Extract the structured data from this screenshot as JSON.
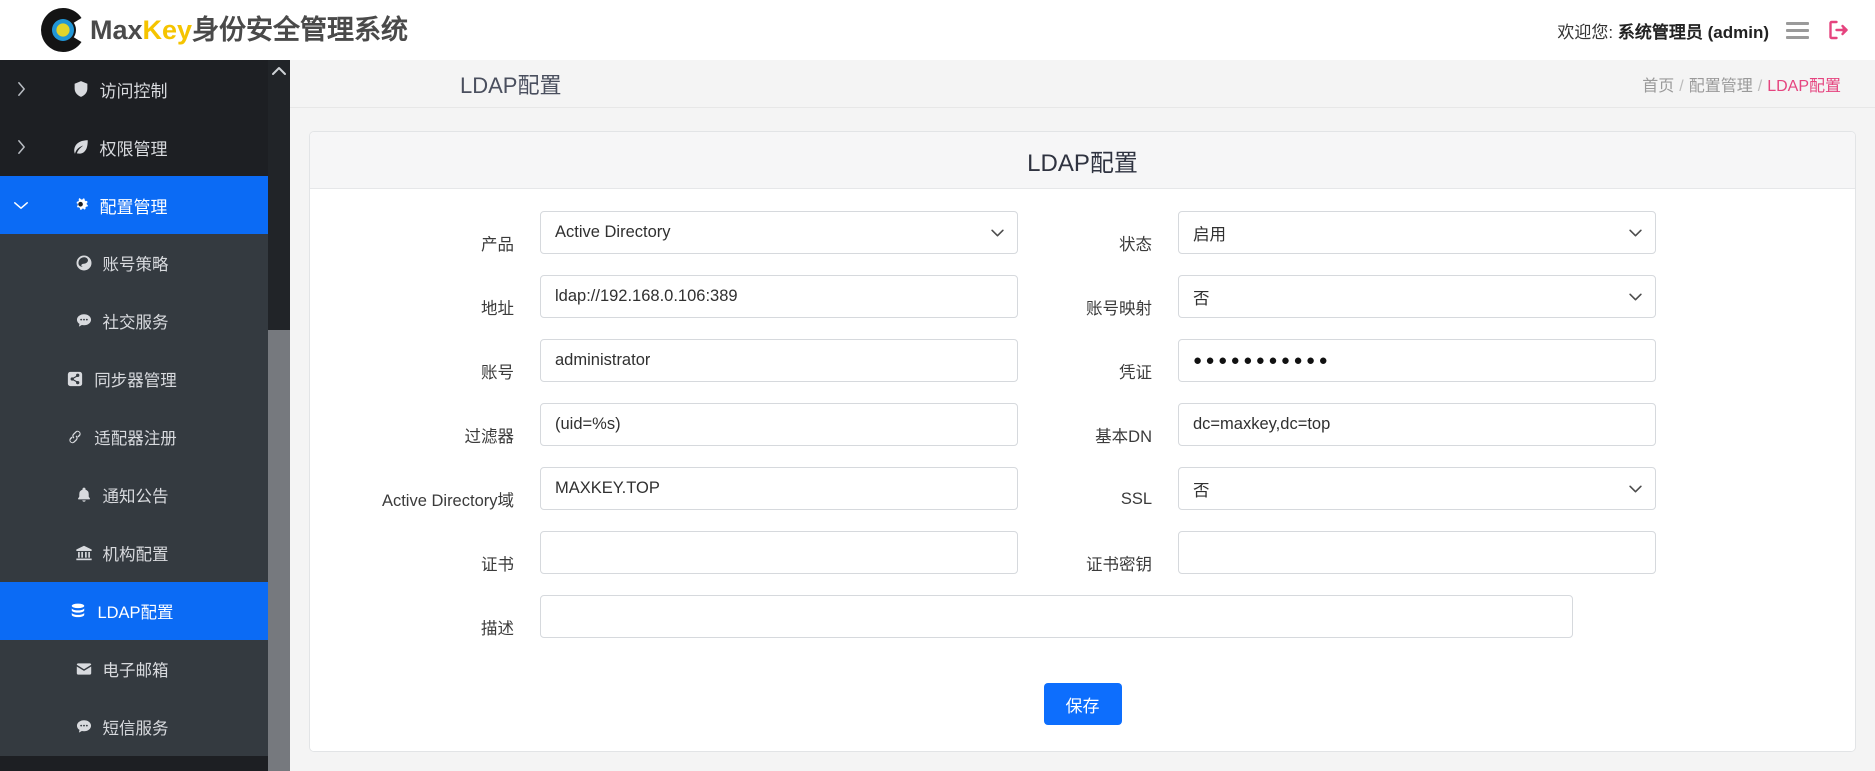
{
  "header": {
    "brand_max": "Max",
    "brand_key": "Key",
    "brand_cn": "身份安全管理系统",
    "welcome_prefix": "欢迎您:",
    "user_name": "系统管理员 (admin)",
    "menu_icon": "hamburger-menu-icon",
    "logout_icon": "sign-out-icon"
  },
  "sidebar": {
    "scroll_up_icon": "chevron-up-icon",
    "items": [
      {
        "label": "访问控制",
        "icon": "shield-icon",
        "caret": "chevron-right-icon",
        "level": "top",
        "active": false
      },
      {
        "label": "权限管理",
        "icon": "leaf-icon",
        "caret": "chevron-right-icon",
        "level": "top",
        "active": false
      },
      {
        "label": "配置管理",
        "icon": "gears-icon",
        "caret": "chevron-down-icon",
        "level": "top",
        "active": true
      },
      {
        "label": "账号策略",
        "icon": "hurricane-icon",
        "caret": "",
        "level": "sub",
        "active": false
      },
      {
        "label": "社交服务",
        "icon": "comment-dots-icon",
        "caret": "",
        "level": "sub",
        "active": false
      },
      {
        "label": "同步器管理",
        "icon": "share-square-icon",
        "caret": "",
        "level": "sub",
        "active": false
      },
      {
        "label": "适配器注册",
        "icon": "link-icon",
        "caret": "",
        "level": "sub",
        "active": false
      },
      {
        "label": "通知公告",
        "icon": "bell-icon",
        "caret": "",
        "level": "sub",
        "active": false
      },
      {
        "label": "机构配置",
        "icon": "bank-icon",
        "caret": "",
        "level": "sub",
        "active": false
      },
      {
        "label": "LDAP配置",
        "icon": "database-icon",
        "caret": "",
        "level": "sub",
        "active": true
      },
      {
        "label": "电子邮箱",
        "icon": "envelope-icon",
        "caret": "",
        "level": "sub",
        "active": false
      },
      {
        "label": "短信服务",
        "icon": "comment-dots-icon",
        "caret": "",
        "level": "sub",
        "active": false
      }
    ]
  },
  "page": {
    "title": "LDAP配置",
    "breadcrumb": [
      "首页",
      "配置管理",
      "LDAP配置"
    ],
    "breadcrumb_separator": "/"
  },
  "card": {
    "title": "LDAP配置",
    "fields": {
      "product": {
        "label": "产品",
        "value": "Active Directory",
        "type": "select"
      },
      "status": {
        "label": "状态",
        "value": "启用",
        "type": "select"
      },
      "address": {
        "label": "地址",
        "value": "ldap://192.168.0.106:389",
        "type": "text"
      },
      "account_mapping": {
        "label": "账号映射",
        "value": "否",
        "type": "select"
      },
      "account": {
        "label": "账号",
        "value": "administrator",
        "type": "text"
      },
      "credential": {
        "label": "凭证",
        "value": "●●●●●●●●●●●",
        "type": "password"
      },
      "filter": {
        "label": "过滤器",
        "value": "(uid=%s)",
        "type": "text"
      },
      "base_dn": {
        "label": "基本DN",
        "value": "dc=maxkey,dc=top",
        "type": "text"
      },
      "ad_domain": {
        "label": "Active Directory域",
        "value": "MAXKEY.TOP",
        "type": "text"
      },
      "ssl": {
        "label": "SSL",
        "value": "否",
        "type": "select"
      },
      "certificate": {
        "label": "证书",
        "value": "",
        "type": "text"
      },
      "certificate_key": {
        "label": "证书密钥",
        "value": "",
        "type": "text"
      },
      "description": {
        "label": "描述",
        "value": "",
        "type": "text"
      }
    },
    "save_label": "保存"
  },
  "colors": {
    "accent_blue": "#0d6efd",
    "sidebar_bg": "#1d1f23",
    "sidebar_sub_bg": "#343a40",
    "breadcrumb_active": "#e5447f",
    "logout_icon": "#e5447f",
    "brand_yellow": "#f5c400"
  }
}
